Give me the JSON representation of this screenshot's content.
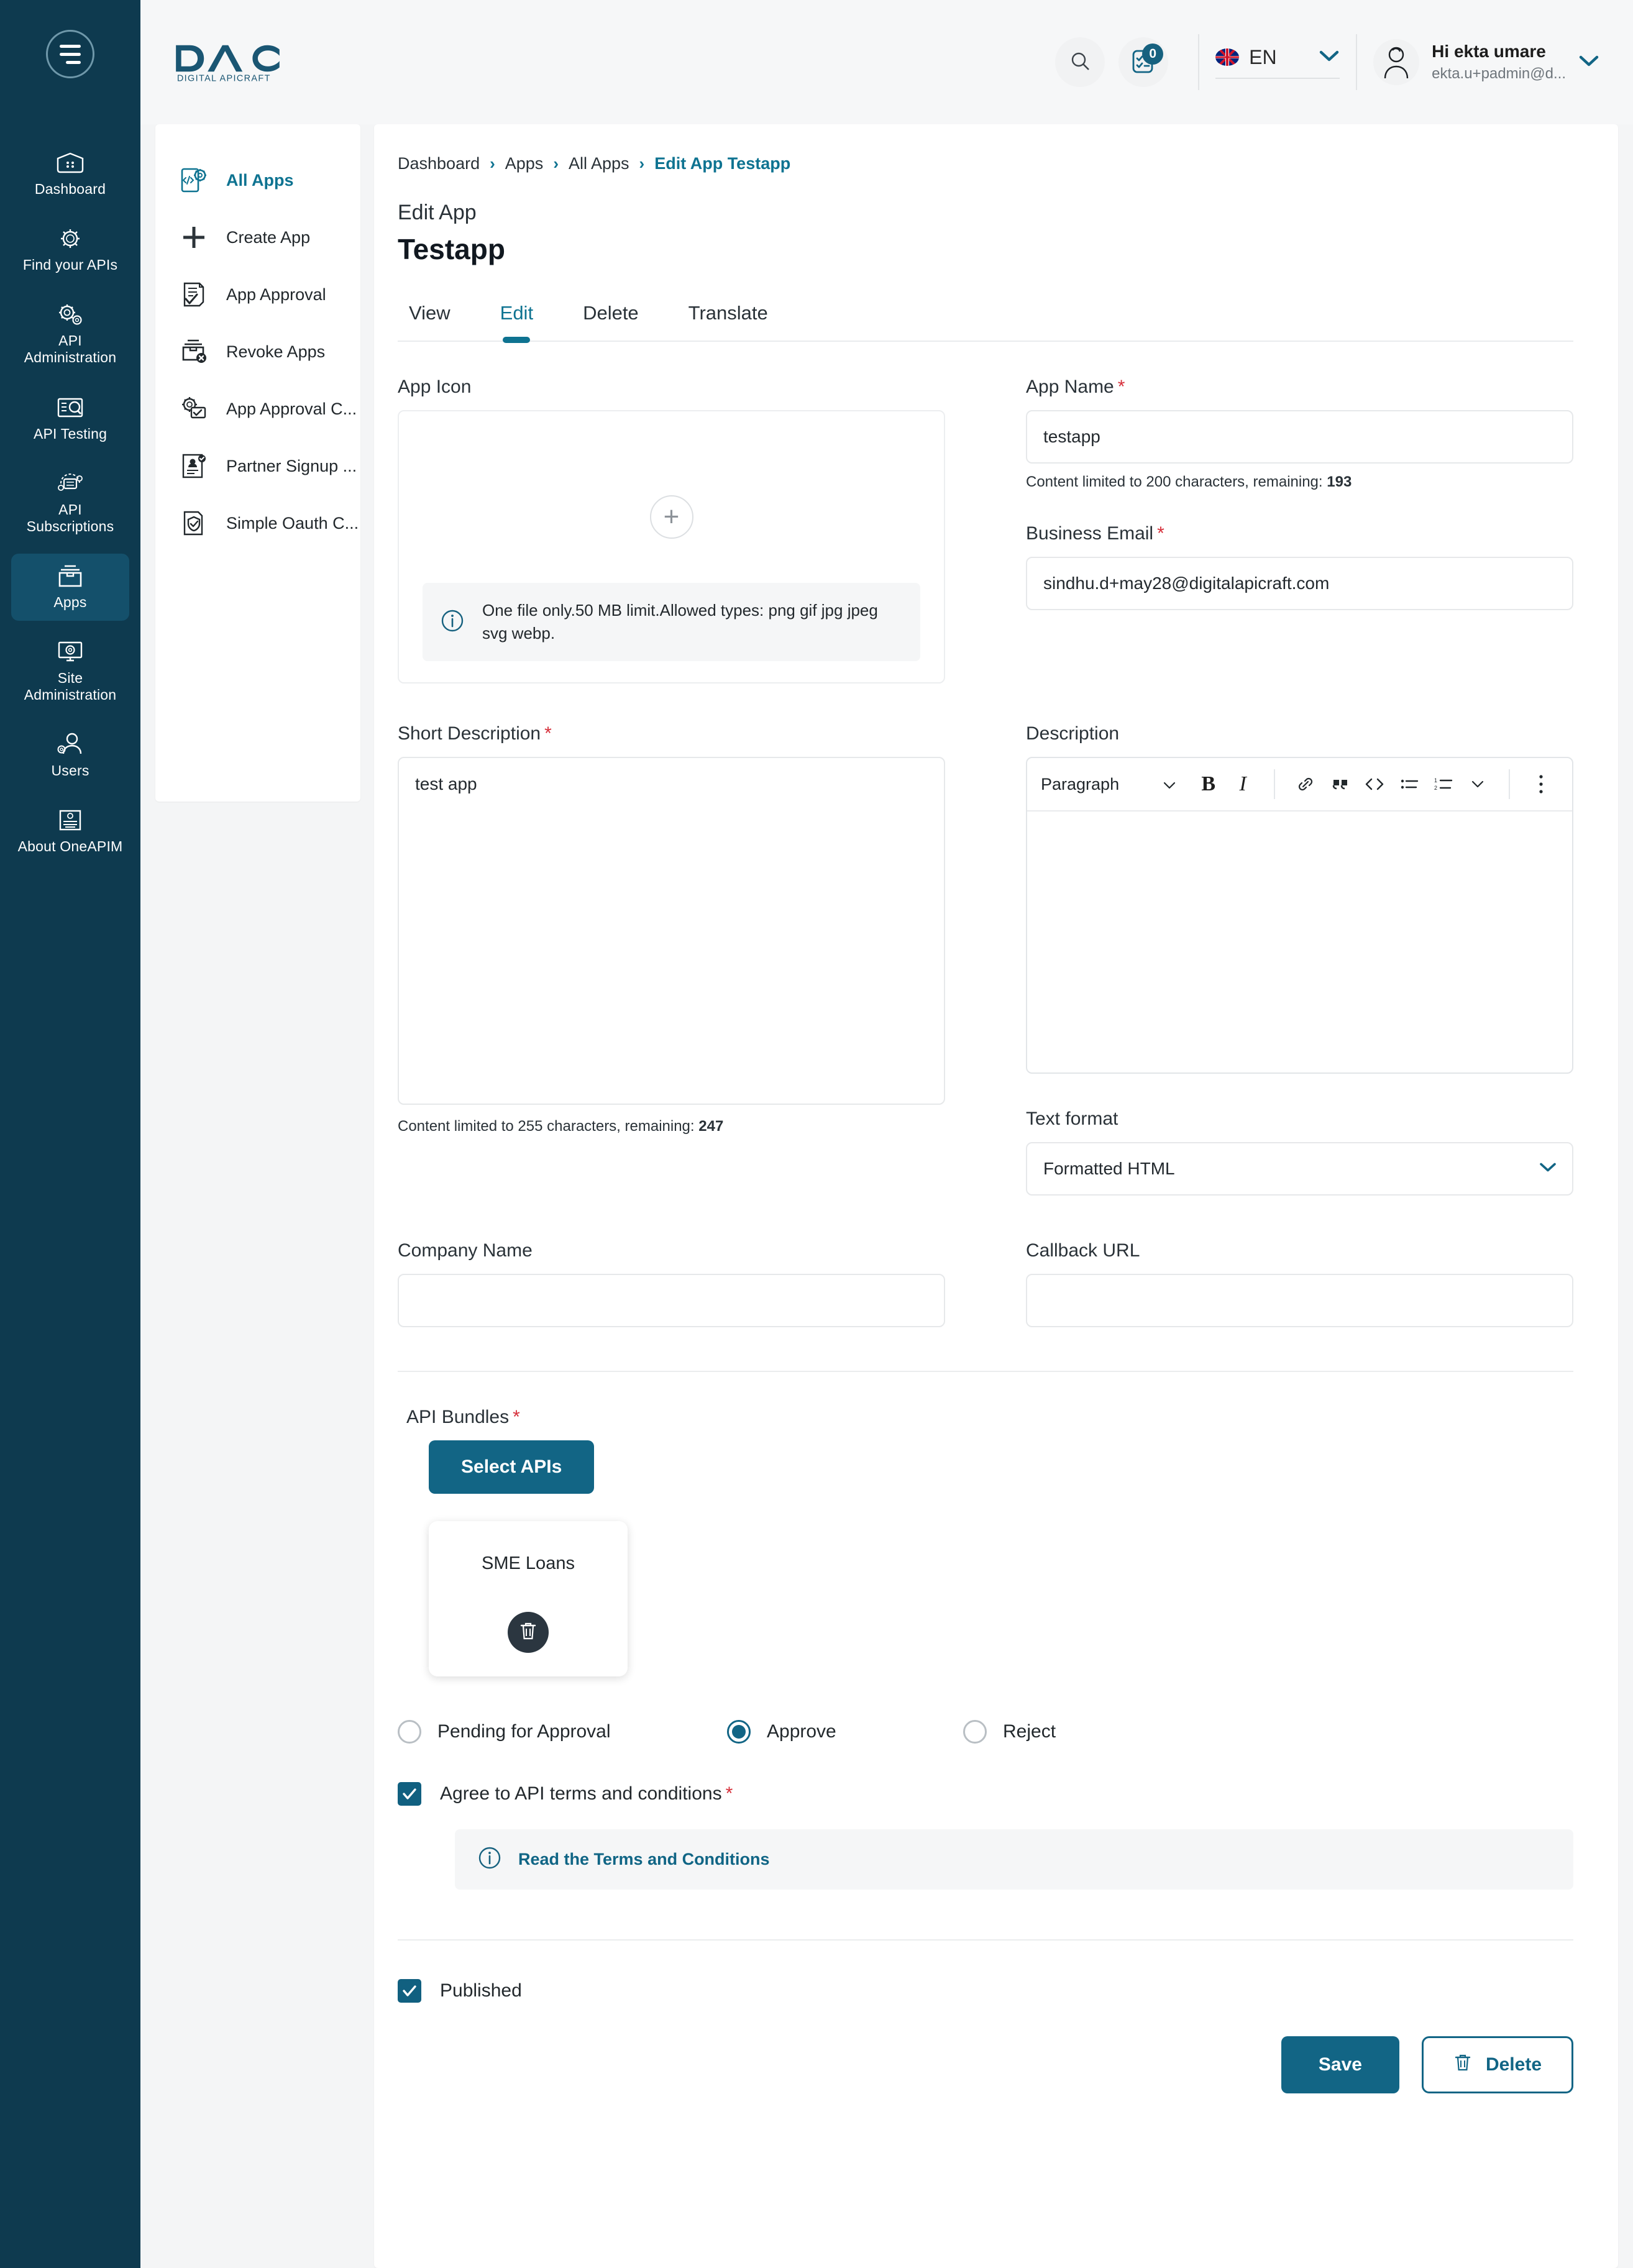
{
  "brand": {
    "logo_main": "DAC",
    "logo_sub": "DIGITAL APICRAFT",
    "accent": "#126585",
    "rail_bg": "#0e3a4f",
    "rail_active_bg": "#14506b",
    "link_color": "#0e7391",
    "required_color": "#d6303b"
  },
  "header": {
    "search_icon": "search-icon",
    "tasks_icon": "tasks-checklist-icon",
    "tasks_badge": "0",
    "language": "EN",
    "language_flag": "uk-flag-icon",
    "user_greeting": "Hi ekta umare",
    "user_email": "ekta.u+padmin@d...",
    "chevron_icon": "chevron-down-icon"
  },
  "rail": {
    "menu_icon": "hamburger-menu-icon",
    "items": [
      {
        "label": "Dashboard",
        "icon": "dashboard-icon",
        "active": false
      },
      {
        "label": "Find your APIs",
        "icon": "find-apis-icon",
        "active": false
      },
      {
        "label": "API\nAdministration",
        "icon": "api-administration-icon",
        "active": false
      },
      {
        "label": "API Testing",
        "icon": "api-testing-icon",
        "active": false
      },
      {
        "label": "API\nSubscriptions",
        "icon": "api-subscriptions-icon",
        "active": false
      },
      {
        "label": "Apps",
        "icon": "apps-icon",
        "active": true
      },
      {
        "label": "Site\nAdministration",
        "icon": "site-administration-icon",
        "active": false
      },
      {
        "label": "Users",
        "icon": "users-icon",
        "active": false
      },
      {
        "label": "About OneAPIM",
        "icon": "about-oneapim-icon",
        "active": false
      }
    ]
  },
  "submenu": {
    "items": [
      {
        "label": "All Apps",
        "icon": "all-apps-icon",
        "active": true
      },
      {
        "label": "Create App",
        "icon": "plus-icon",
        "active": false
      },
      {
        "label": "App Approval",
        "icon": "app-approval-icon",
        "active": false
      },
      {
        "label": "Revoke Apps",
        "icon": "revoke-apps-icon",
        "active": false
      },
      {
        "label": "App Approval C...",
        "icon": "app-approval-config-icon",
        "active": false
      },
      {
        "label": "Partner Signup ...",
        "icon": "partner-signup-icon",
        "active": false
      },
      {
        "label": "Simple Oauth C...",
        "icon": "simple-oauth-icon",
        "active": false
      }
    ]
  },
  "breadcrumb": {
    "items": [
      "Dashboard",
      "Apps",
      "All Apps",
      "Edit App Testapp"
    ],
    "separator": "›"
  },
  "page": {
    "kicker": "Edit App",
    "title": "Testapp"
  },
  "tabs": [
    {
      "label": "View",
      "active": false
    },
    {
      "label": "Edit",
      "active": true
    },
    {
      "label": "Delete",
      "active": false
    },
    {
      "label": "Translate",
      "active": false
    }
  ],
  "form": {
    "app_icon": {
      "label": "App Icon",
      "add_icon": "plus-icon",
      "info_icon": "info-circle-icon",
      "info_text": "One file only.50 MB limit.Allowed types: png gif jpg jpeg svg webp."
    },
    "app_name": {
      "label": "App Name",
      "required": true,
      "value": "testapp",
      "placeholder": "",
      "hint_prefix": "Content limited to 200 characters, remaining: ",
      "hint_value": "193"
    },
    "business_email": {
      "label": "Business Email",
      "required": true,
      "value": "sindhu.d+may28@digitalapicraft.com",
      "placeholder": ""
    },
    "short_description": {
      "label": "Short Description",
      "required": true,
      "value": "test app",
      "placeholder": "",
      "hint_prefix": "Content limited to 255 characters, remaining: ",
      "hint_value": "247"
    },
    "description": {
      "label": "Description",
      "value": "",
      "toolbar": {
        "style_select": "Paragraph",
        "buttons": [
          {
            "name": "bold-icon",
            "glyph": "B"
          },
          {
            "name": "italic-icon",
            "glyph": "I"
          },
          {
            "name": "link-icon",
            "glyph": "link"
          },
          {
            "name": "blockquote-icon",
            "glyph": "quote"
          },
          {
            "name": "code-icon",
            "glyph": "<>"
          },
          {
            "name": "bullet-list-icon",
            "glyph": "ul"
          },
          {
            "name": "numbered-list-icon",
            "glyph": "ol"
          },
          {
            "name": "chevron-down-icon",
            "glyph": "chev"
          },
          {
            "name": "more-vertical-icon",
            "glyph": "dots"
          }
        ]
      }
    },
    "text_format": {
      "label": "Text format",
      "value": "Formatted HTML",
      "options": [
        "Formatted HTML"
      ]
    },
    "company_name": {
      "label": "Company Name",
      "value": "",
      "placeholder": ""
    },
    "callback_url": {
      "label": "Callback URL",
      "value": "",
      "placeholder": ""
    },
    "api_bundles": {
      "label": "API Bundles",
      "required": true,
      "select_button": "Select APIs",
      "cards": [
        {
          "name": "SME Loans",
          "delete_icon": "trash-icon"
        }
      ]
    },
    "approval_status": {
      "options": [
        {
          "label": "Pending for Approval",
          "selected": false
        },
        {
          "label": "Approve",
          "selected": true
        },
        {
          "label": "Reject",
          "selected": false
        }
      ]
    },
    "agree_terms": {
      "label": "Agree to API terms and conditions",
      "required": true,
      "checked": true,
      "info_icon": "info-circle-icon",
      "link_text": "Read the Terms and Conditions"
    },
    "published": {
      "label": "Published",
      "checked": true
    }
  },
  "actions": {
    "save_label": "Save",
    "delete_label": "Delete",
    "delete_icon": "trash-icon"
  }
}
